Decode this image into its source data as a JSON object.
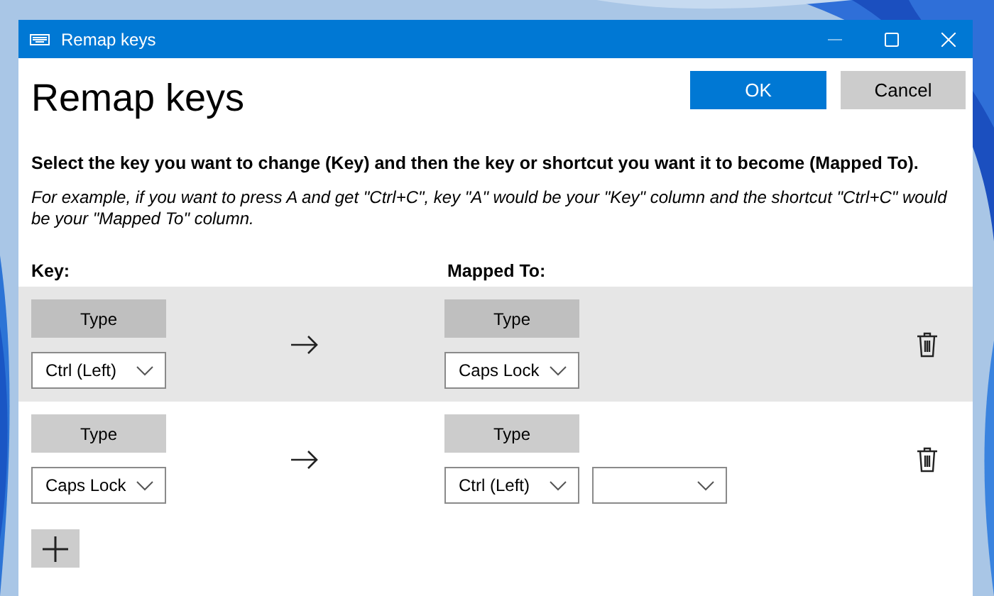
{
  "window": {
    "title": "Remap keys"
  },
  "heading": "Remap keys",
  "buttons": [
    {
      "label": "OK",
      "kind": "primary"
    },
    {
      "label": "Cancel",
      "kind": "secondary"
    }
  ],
  "instruction": "Select the key you want to change (Key) and then the key or shortcut you want it to become (Mapped To).",
  "example": "For example, if you want to press A and get \"Ctrl+C\", key \"A\" would be your \"Key\" column and the shortcut \"Ctrl+C\" would be your \"Mapped To\" column.",
  "columns": [
    "Key:",
    "Mapped To:"
  ],
  "rows": [
    {
      "selected": true,
      "key_type_button": "Type",
      "key": "Ctrl (Left)",
      "mapped_type_button": "Type",
      "mapped": "Caps Lock",
      "has_empty_dropdown": false
    },
    {
      "selected": false,
      "key_type_button": "Type",
      "key": "Caps Lock",
      "mapped_type_button": "Type",
      "mapped": "Ctrl (Left)",
      "has_empty_dropdown": true
    }
  ]
}
